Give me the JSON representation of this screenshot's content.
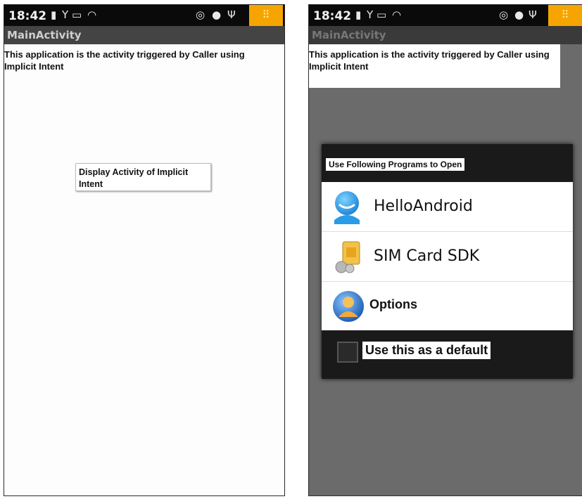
{
  "left_screen": {
    "status_time": "18:42",
    "title": "MainActivity",
    "body_text": "This application is the activity triggered by Caller using Implicit Intent",
    "button_label": "Display Activity of Implicit Intent"
  },
  "right_screen": {
    "status_time": "18:42",
    "title": "MainActivity",
    "body_text": "This application is the activity triggered by Caller using Implicit Intent",
    "dialog": {
      "title": "Use Following Programs to Open",
      "items": [
        {
          "label": "HelloAndroid",
          "icon": "android-app-icon"
        },
        {
          "label": "SIM Card SDK",
          "icon": "sim-card-icon"
        },
        {
          "label": "Options",
          "icon": "user-icon"
        }
      ],
      "default_label": "Use this as a default",
      "default_checked": false
    }
  },
  "colors": {
    "status_bar": "#0a0a0a",
    "notification_box": "#f6a400",
    "title_bar": "#444444",
    "dim_overlay": "#6b6b6b"
  }
}
